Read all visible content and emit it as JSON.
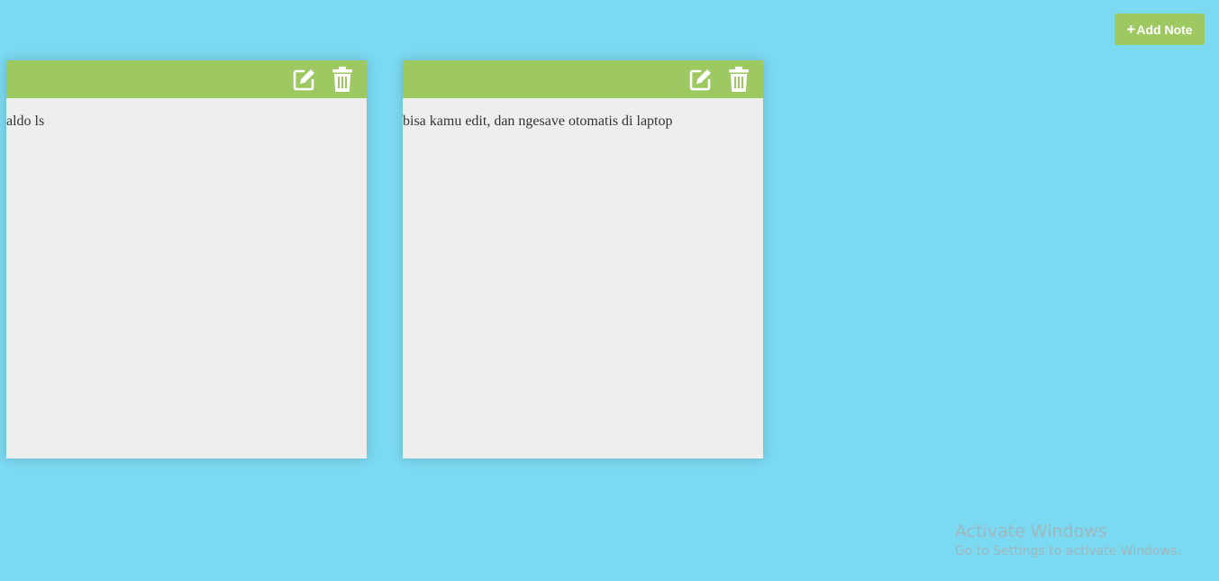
{
  "toolbar": {
    "add_note_label": "Add Note",
    "add_note_icon": "plus-icon"
  },
  "notes": [
    {
      "text": "aldo ls",
      "edit_icon": "edit-icon",
      "delete_icon": "trash-icon"
    },
    {
      "text": "bisa kamu edit, dan ngesave otomatis di laptop",
      "edit_icon": "edit-icon",
      "delete_icon": "trash-icon"
    }
  ],
  "watermark": {
    "title": "Activate Windows",
    "subtitle": "Go to Settings to activate Windows."
  },
  "colors": {
    "background": "#7bd9f1",
    "accent": "#9ec962",
    "note_body": "#eeeeee"
  }
}
